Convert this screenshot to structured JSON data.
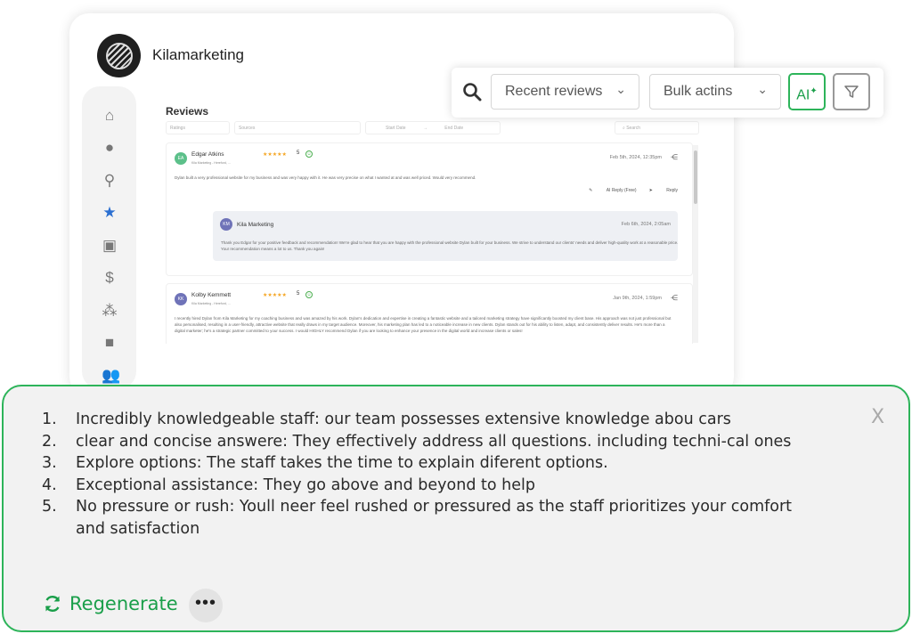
{
  "app": {
    "brand": "Kilamarketing"
  },
  "sidebar": {
    "items": [
      {
        "icon": "home-icon",
        "glyph": "⌂"
      },
      {
        "icon": "chat-icon",
        "glyph": "●"
      },
      {
        "icon": "location-pin-icon",
        "glyph": "⚲"
      },
      {
        "icon": "star-icon",
        "glyph": "★",
        "active": true
      },
      {
        "icon": "gift-icon",
        "glyph": "▣"
      },
      {
        "icon": "dollar-icon",
        "glyph": "$"
      },
      {
        "icon": "integrations-icon",
        "glyph": "⁂"
      },
      {
        "icon": "copy-icon",
        "glyph": "■"
      },
      {
        "icon": "users-icon",
        "glyph": "👥"
      }
    ]
  },
  "reviews": {
    "title": "Reviews",
    "filters": {
      "ratings": "Ratings",
      "sources": "Sources",
      "start_date": "Start Date",
      "arrow": "→",
      "end_date": "End Date",
      "search": "Search"
    },
    "items": [
      {
        "initials": "EA",
        "avatar_color": "#5cc08a",
        "name": "Edgar Atkins",
        "source": "Kila Marketing - Hereford, ...",
        "stars": "★★★★★",
        "rating": "5",
        "date": "Feb 5th, 2024, 12:35pm",
        "text": "Dylan built a very professional website for my business and was very happy with it. He was very precise on what I wanted at and was well priced. Would very recommend.",
        "ai_reply": "AI Reply (Free)",
        "reply": "Reply",
        "response": {
          "initials": "KM",
          "name": "Kila Marketing",
          "date": "Feb 6th, 2024, 2:05am",
          "text": "Thank you Edgar for your positive feedback and recommendation! We're glad to hear that you are happy with the professional website Dylan built for your business. We strive to understand our clients' needs and deliver high-quality work at a reasonable price. Your recommendation means a lot to us. Thank you again!"
        }
      },
      {
        "initials": "KK",
        "avatar_color": "#6f73b8",
        "name": "Kolby Kemmett",
        "source": "Kila Marketing - Hereford, ...",
        "stars": "★★★★★",
        "rating": "5",
        "date": "Jan 9th, 2024, 1:59pm",
        "text": "I recently hired Dylan from Kila Marketing for my coaching business and was amazed by his work. Dylan's dedication and expertise in creating a fantastic website and a tailored marketing strategy have significantly boosted my client base. His approach was not just professional but also personalised, resulting in a user-friendly, attractive website that really draws in my target audience. Moreover, his marketing plan has led to a noticeable increase in new clients. Dylan stands out for his ability to listen, adapt, and consistently deliver results. He's more than a digital marketer; he's a strategic partner committed to your success. I would HIGHLY recommend Dylan if you are looking to enhance your presence in the digital world and increase clients or sales!"
      }
    ]
  },
  "toolbar": {
    "recent": "Recent reviews",
    "bulk": "Bulk actins",
    "ai": "AI"
  },
  "suggestions": {
    "items": [
      {
        "n": "1.",
        "text": "Incredibly knowledgeable staff: our team possesses extensive knowledge abou cars"
      },
      {
        "n": "2.",
        "text": "clear and concise answere: They effectively address all questions. including techni-cal ones"
      },
      {
        "n": "3.",
        "text": "Explore options: The staff takes the time to explain diferent options."
      },
      {
        "n": "4.",
        "text": "Exceptional assistance: They go above and beyond to help"
      },
      {
        "n": "5.",
        "text": "No pressure or rush: Youll neer feel rushed or pressured as the staff prioritizes your comfort and satisfaction"
      }
    ],
    "close": "X",
    "regenerate": "Regenerate",
    "more": "•••"
  },
  "colors": {
    "accent": "#1a9f4a",
    "border": "#2db45a",
    "active_icon": "#2b6fd1"
  }
}
